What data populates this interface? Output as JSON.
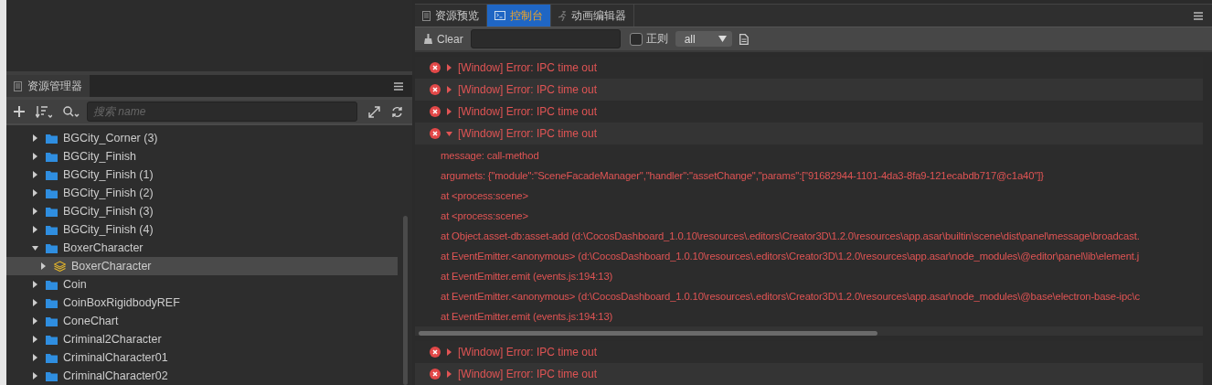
{
  "assets_panel": {
    "title": "资源管理器",
    "search": {
      "placeholder": "搜索 name"
    },
    "tree": [
      {
        "name": "BGCity_Corner (3)",
        "kind": "folder",
        "expanded": false,
        "selected": false
      },
      {
        "name": "BGCity_Finish",
        "kind": "folder",
        "expanded": false,
        "selected": false
      },
      {
        "name": "BGCity_Finish (1)",
        "kind": "folder",
        "expanded": false,
        "selected": false
      },
      {
        "name": "BGCity_Finish (2)",
        "kind": "folder",
        "expanded": false,
        "selected": false
      },
      {
        "name": "BGCity_Finish (3)",
        "kind": "folder",
        "expanded": false,
        "selected": false
      },
      {
        "name": "BGCity_Finish (4)",
        "kind": "folder",
        "expanded": false,
        "selected": false
      },
      {
        "name": "BoxerCharacter",
        "kind": "folder",
        "expanded": true,
        "selected": false,
        "children": [
          {
            "name": "BoxerCharacter",
            "kind": "prefab",
            "expanded": false,
            "selected": true
          }
        ]
      },
      {
        "name": "Coin",
        "kind": "folder",
        "expanded": false,
        "selected": false
      },
      {
        "name": "CoinBoxRigidbodyREF",
        "kind": "folder",
        "expanded": false,
        "selected": false
      },
      {
        "name": "ConeChart",
        "kind": "folder",
        "expanded": false,
        "selected": false
      },
      {
        "name": "Criminal2Character",
        "kind": "folder",
        "expanded": false,
        "selected": false
      },
      {
        "name": "CriminalCharacter01",
        "kind": "folder",
        "expanded": false,
        "selected": false
      },
      {
        "name": "CriminalCharacter02",
        "kind": "folder",
        "expanded": false,
        "selected": false
      }
    ]
  },
  "console": {
    "tabs": [
      {
        "label": "资源预览",
        "kind": "preview",
        "selected": false
      },
      {
        "label": "控制台",
        "kind": "console",
        "selected": true
      },
      {
        "label": "动画编辑器",
        "kind": "animation",
        "selected": false
      }
    ],
    "toolbar": {
      "clear": "Clear",
      "regex": {
        "label": "正则",
        "checked": false
      },
      "level_select": "all"
    },
    "logs": [
      {
        "message": "[Window] Error: IPC time out",
        "expanded": false
      },
      {
        "message": "[Window] Error: IPC time out",
        "expanded": false
      },
      {
        "message": "[Window] Error: IPC time out",
        "expanded": false
      },
      {
        "message": "[Window] Error: IPC time out",
        "expanded": true,
        "details": [
          "message: call-method",
          "argumets: {\"module\":\"SceneFacadeManager\",\"handler\":\"assetChange\",\"params\":[\"91682944-1101-4da3-8fa9-121ecabdb717@c1a40\"]}",
          "at <process:scene>",
          "at <process:scene>",
          "at Object.asset-db:asset-add (d:\\CocosDashboard_1.0.10\\resources\\.editors\\Creator3D\\1.2.0\\resources\\app.asar\\builtin\\scene\\dist\\panel\\message\\broadcast.",
          "at EventEmitter.<anonymous> (d:\\CocosDashboard_1.0.10\\resources\\.editors\\Creator3D\\1.2.0\\resources\\app.asar\\node_modules\\@editor\\panel\\lib\\element.j",
          "at EventEmitter.emit (events.js:194:13)",
          "at EventEmitter.<anonymous> (d:\\CocosDashboard_1.0.10\\resources\\.editors\\Creator3D\\1.2.0\\resources\\app.asar\\node_modules\\@base\\electron-base-ipc\\c",
          "at EventEmitter.emit (events.js:194:13)"
        ]
      },
      {
        "message": "[Window] Error: IPC time out",
        "expanded": false
      },
      {
        "message": "[Window] Error: IPC time out",
        "expanded": false
      }
    ]
  }
}
